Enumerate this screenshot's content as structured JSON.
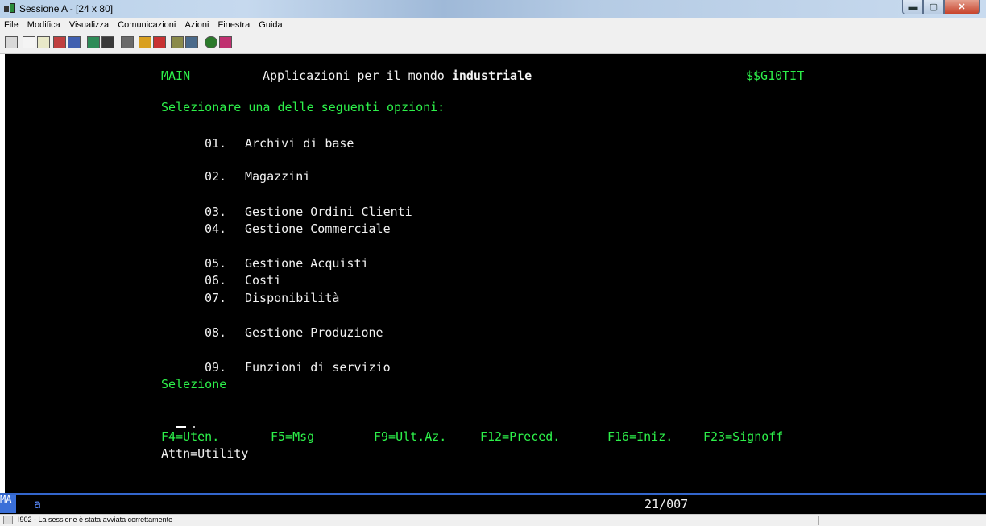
{
  "window": {
    "title": "Sessione A - [24 x 80]",
    "minimize": "▬",
    "maximize": "▢",
    "close": "✕"
  },
  "menu": [
    "File",
    "Modifica",
    "Visualizza",
    "Comunicazioni",
    "Azioni",
    "Finestra",
    "Guida"
  ],
  "screen": {
    "menu_id": "MAIN",
    "title_prefix": "Applicazioni per il mondo ",
    "title_bold": "industriale",
    "program": "$$G10TIT",
    "prompt": "Selezionare una delle seguenti opzioni:",
    "options": [
      {
        "num": "01.",
        "label": "Archivi di base"
      },
      {
        "num": "02.",
        "label": "Magazzini"
      },
      {
        "num": "03.",
        "label": "Gestione Ordini Clienti"
      },
      {
        "num": "04.",
        "label": "Gestione Commerciale"
      },
      {
        "num": "05.",
        "label": "Gestione Acquisti"
      },
      {
        "num": "06.",
        "label": "Costi"
      },
      {
        "num": "07.",
        "label": "Disponibilità"
      },
      {
        "num": "08.",
        "label": "Gestione Produzione"
      },
      {
        "num": "09.",
        "label": "Funzioni di servizio"
      }
    ],
    "selection_label": "Selezione",
    "fkeys": [
      "F4=Uten.",
      "F5=Msg",
      "F9=Ult.Az.",
      "F12=Preced.",
      "F16=Iniz.",
      "F23=Signoff"
    ],
    "attn": "Attn=Utility"
  },
  "oia": {
    "mode": "MA",
    "indicator": "a",
    "cursor_pos": "21/007"
  },
  "status": {
    "text": "I902 - La sessione è stata avviata correttamente"
  },
  "colors": {
    "field_green": "#2df04a",
    "text_white": "#f2f2f2",
    "oia_blue": "#3a6fd8"
  }
}
